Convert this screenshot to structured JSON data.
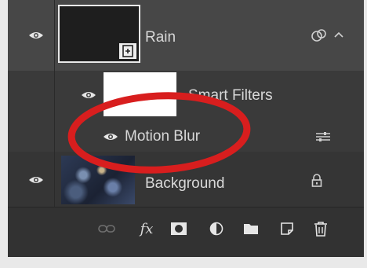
{
  "layers": {
    "rain": {
      "name": "Rain"
    },
    "smart_filters": {
      "name": "Smart Filters"
    },
    "motion_blur": {
      "name": "Motion Blur"
    },
    "background": {
      "name": "Background"
    }
  },
  "icons": {
    "visibility": "eye-icon",
    "smart_object_badge": "smart-object-icon",
    "link": "link-icon",
    "fx": "fx-icon",
    "mask": "layer-mask-icon",
    "adjustment": "adjustment-layer-icon",
    "group": "folder-icon",
    "new_layer": "new-layer-icon",
    "delete": "trash-icon",
    "lock": "lock-icon",
    "filter_options": "filter-options-icon",
    "collapse": "chevron-up-icon",
    "smart_object_indicator": "smart-object-overlay-icon"
  },
  "bottom_toolbar": {
    "fx_label": "fx"
  },
  "colors": {
    "panel_bg": "#323232",
    "selected_row": "#474747",
    "text": "#d8d8d8",
    "annotation_red": "#d81e1e"
  }
}
